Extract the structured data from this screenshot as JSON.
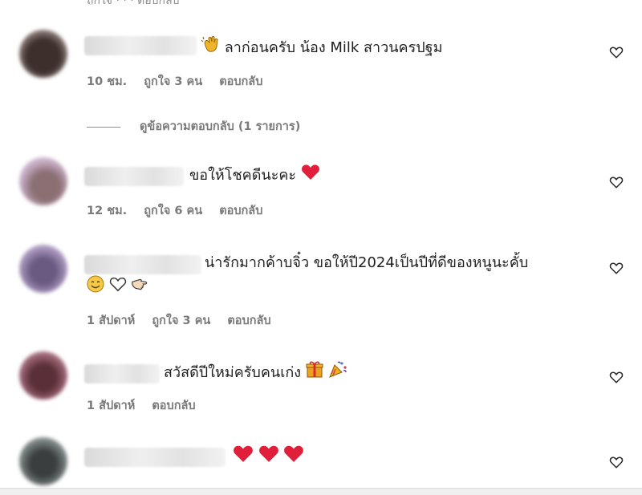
{
  "comments": [
    {
      "avatar_color": "#6b5a55",
      "text": "ลาก่อนครับ น้อง Milk สาวนครปฐม",
      "emoji_prefix": "waving-hand",
      "time": "10 ชม.",
      "likes": "ถูกใจ 3 คน",
      "reply": "ตอบกลับ"
    },
    {
      "avatar_color": "#b8a0b6",
      "text": "ขอให้โชคดีนะคะ",
      "time": "12 ชม.",
      "likes": "ถูกใจ 6 คน",
      "reply": "ตอบกลับ"
    },
    {
      "avatar_color": "#8f7da3",
      "text": "น่ารักมากค้าบจิ๋ว ขอให้ปี2024เป็นปีที่ดีของหนูนะคั้บ",
      "time": "1 สัปดาห์",
      "likes": "ถูกใจ 3 คน",
      "reply": "ตอบกลับ"
    },
    {
      "avatar_color": "#8e5a6a",
      "text": "สวัสดีปีใหม่ครับคนเก่ง",
      "time": "1 สัปดาห์",
      "reply": "ตอบกลับ"
    },
    {
      "avatar_color": "#5e6464",
      "text": ""
    }
  ],
  "view_replies": "ดูข้อความตอบกลับ (1 รายการ)",
  "colors": {
    "heart_red": "#e0203a",
    "meta_gray": "#7a7a7a"
  },
  "icons": [
    "heart-outline-icon",
    "waving-hand-emoji",
    "red-heart-emoji",
    "smiling-face-emoji",
    "white-heart-emoji",
    "pointing-hand-emoji",
    "gift-emoji",
    "party-popper-emoji"
  ]
}
